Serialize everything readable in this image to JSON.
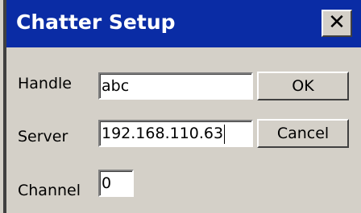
{
  "window": {
    "title": "Chatter Setup",
    "close_glyph": "✕",
    "close_icon": "close-icon",
    "title_color": "#0a2ca5",
    "face_color": "#d4d0c8"
  },
  "form": {
    "handle": {
      "label": "Handle",
      "value": "abc"
    },
    "server": {
      "label": "Server",
      "value": "192.168.110.63"
    },
    "channel": {
      "label": "Channel",
      "value": "0"
    }
  },
  "buttons": {
    "ok_label": "OK",
    "cancel_label": "Cancel"
  }
}
